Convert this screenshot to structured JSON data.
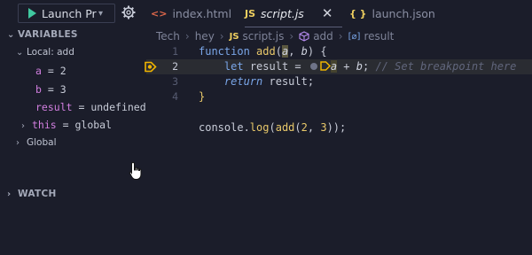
{
  "topbar": {
    "launch_config": "Launch Program",
    "tabs": [
      {
        "label": "index.html",
        "icon": "<>"
      },
      {
        "label": "script.js",
        "icon": "JS"
      },
      {
        "label": "launch.json",
        "icon": "{ }"
      }
    ],
    "close_glyph": "✕"
  },
  "side": {
    "variables_header": "VARIABLES",
    "local_scope": "Local: add",
    "vars": [
      {
        "name": "a",
        "value": "2"
      },
      {
        "name": "b",
        "value": "3"
      },
      {
        "name": "result",
        "value": "undefined"
      },
      {
        "name": "this",
        "value": "global"
      }
    ],
    "eq": " = ",
    "global_scope": "Global",
    "watch_header": "WATCH"
  },
  "editor": {
    "breadcrumb": [
      "Tech",
      "hey",
      "script.js",
      "add",
      "result"
    ],
    "breadcrumb_js": "JS",
    "line_numbers": [
      "1",
      "2",
      "3",
      "4",
      "5"
    ],
    "code": {
      "l1_kw": "function ",
      "l1_fn": "add",
      "l1_open": "(",
      "l1_a": "a",
      "l1_mid": ", ",
      "l1_b": "b",
      "l1_close": ") {",
      "l2_indent": "    ",
      "l2_kw": "let",
      "l2_rest": " result = ",
      "l2_a": "a",
      "l2_plus": " + ",
      "l2_b": "b",
      "l2_semi": ";",
      "l2_cmt": " // Set breakpoint here",
      "l3_indent": "    ",
      "l3_ret": "return",
      "l3_rest": " result;",
      "l4": "}",
      "l5_pre": "console.",
      "l5_fn1": "log",
      "l5_open": "(",
      "l5_fn2": "add",
      "l5_open2": "(",
      "l5_n1": "2",
      "l5_comma": ", ",
      "l5_n2": "3",
      "l5_close": "));"
    }
  },
  "colors": {
    "background": "#1b1d2a",
    "keyword": "#7aa6e8",
    "function": "#e8c86a",
    "variable_name": "#d27fe0",
    "breakpoint": "#f0b400",
    "comment": "#61667c"
  }
}
